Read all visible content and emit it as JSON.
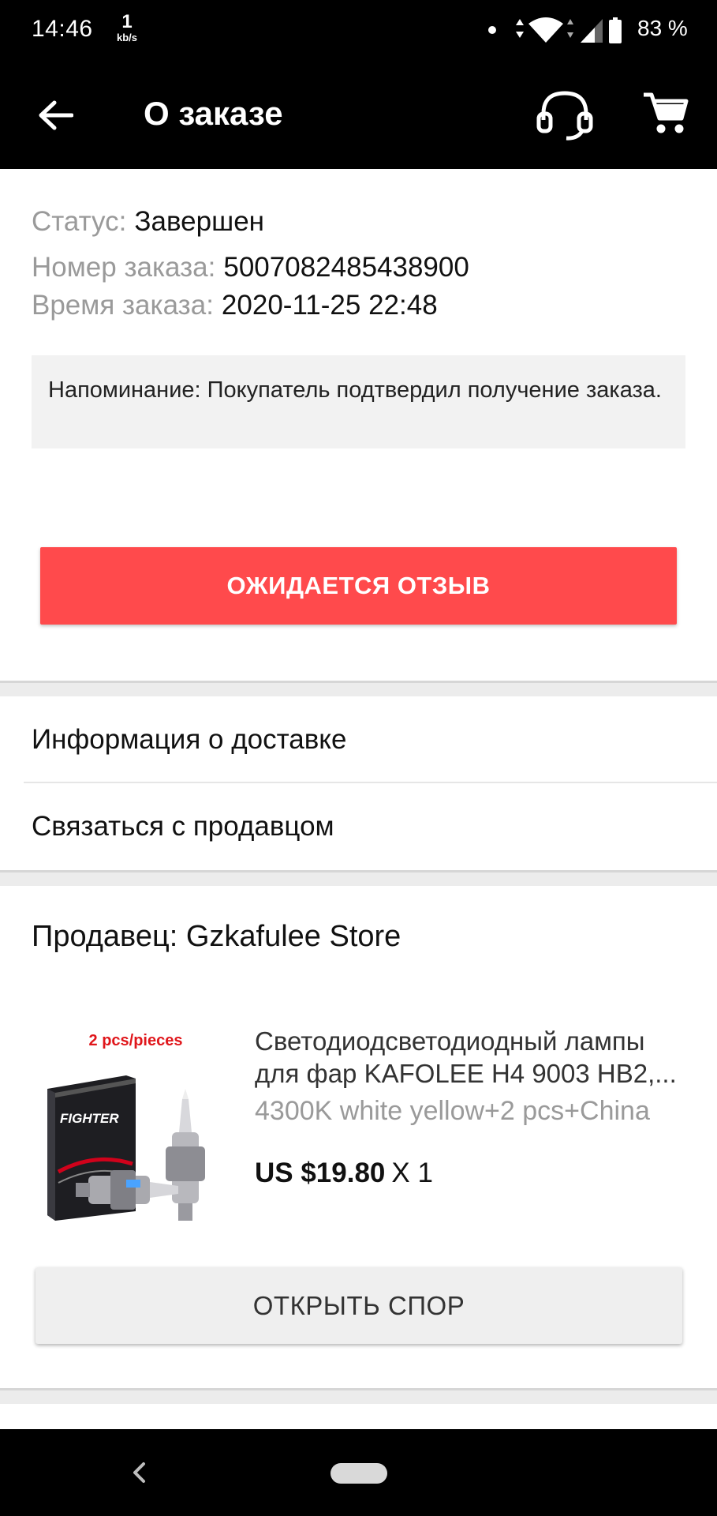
{
  "status_bar": {
    "time": "14:46",
    "net_speed_value": "1",
    "net_speed_unit": "kb/s",
    "battery_percent": "83 %",
    "icons": [
      "notification-dot",
      "data-arrows-icon",
      "wifi-icon",
      "signal-icon",
      "battery-icon"
    ]
  },
  "app_bar": {
    "title": "О заказе",
    "icons": [
      "back-arrow-icon",
      "headset-icon",
      "cart-icon"
    ]
  },
  "order": {
    "status_label": "Статус:",
    "status_value": "Завершен",
    "number_label": "Номер заказа:",
    "number_value": "5007082485438900",
    "time_label": "Время заказа:",
    "time_value": "2020-11-25 22:48",
    "reminder": "Напоминание: Покупатель подтвердил получение заказа.",
    "review_button": "ОЖИДАЕТСЯ ОТЗЫВ"
  },
  "links": {
    "delivery": "Информация о доставке",
    "contact_seller": "Связаться с продавцом"
  },
  "product": {
    "seller": "Продавец: Gzkafulee Store",
    "image_caption": "2 pcs/pieces",
    "image_brand": "FIGHTER",
    "title": "Светодиодсветодиодный лампы для фар KAFOLEE H4 9003 HB2,...",
    "variant": "4300K white yellow+2 pcs+China",
    "price": "US $19.80",
    "quantity": "X 1",
    "dispute_button": "ОТКРЫТЬ СПОР"
  },
  "colors": {
    "accent_red": "#ff4a4c",
    "bar_black": "#000000",
    "muted_gray": "#9a9a9a"
  }
}
